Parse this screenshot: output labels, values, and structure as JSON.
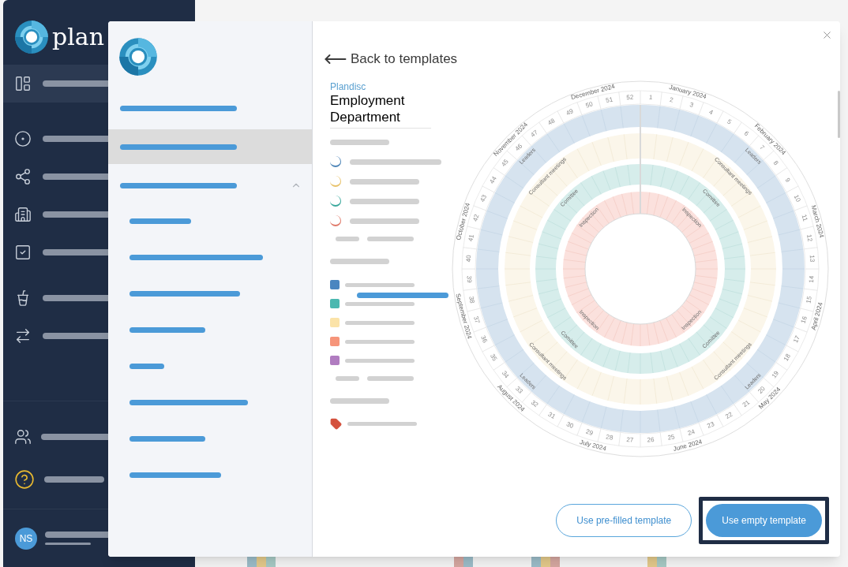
{
  "sidebar": {
    "logo_text": "plan",
    "items": [
      {
        "selected": true
      },
      {
        "selected": false
      },
      {
        "selected": false
      },
      {
        "selected": false
      },
      {
        "selected": false
      },
      {
        "selected": false
      },
      {
        "selected": false
      }
    ],
    "bottom_items": [
      {
        "selected": false
      },
      {
        "selected": false
      }
    ],
    "user": {
      "initials": "NS"
    }
  },
  "modal": {
    "nav": {
      "items": [
        {
          "selected": false
        },
        {
          "selected": true
        },
        {
          "selected": false,
          "expanded": true,
          "children": [
            {
              "selected": false
            },
            {
              "selected": false
            },
            {
              "selected": false
            },
            {
              "selected": false
            },
            {
              "selected": false
            },
            {
              "selected": false
            },
            {
              "selected": false
            },
            {
              "selected": false
            }
          ]
        }
      ]
    },
    "back_link": "Back to templates",
    "template": {
      "brand": "Plandisc",
      "title": "Employment Department",
      "ring_legend": [
        {
          "color": "#4f86b8"
        },
        {
          "color": "#e8c26a"
        },
        {
          "color": "#3aa89c"
        },
        {
          "color": "#e07a6a"
        }
      ],
      "category_legend": [
        {
          "color": "#4a86c0"
        },
        {
          "color": "#4ab8b0"
        },
        {
          "color": "#fbe3a8"
        },
        {
          "color": "#f6957a"
        },
        {
          "color": "#b07cc0"
        }
      ]
    },
    "wheel": {
      "months": [
        "January 2024",
        "February 2024",
        "March 2024",
        "April 2024",
        "May 2024",
        "June 2024",
        "July 2024",
        "August 2024",
        "September 2024",
        "October 2024",
        "November 2024",
        "December 2024"
      ],
      "weeks": [
        "1",
        "2",
        "3",
        "4",
        "5",
        "6",
        "7",
        "8",
        "9",
        "10",
        "11",
        "12",
        "13",
        "14",
        "15",
        "16",
        "17",
        "18",
        "19",
        "20",
        "21",
        "22",
        "23",
        "24",
        "25",
        "26",
        "27",
        "28",
        "29",
        "30",
        "31",
        "32",
        "33",
        "34",
        "35",
        "36",
        "37",
        "38",
        "39",
        "40",
        "41",
        "42",
        "43",
        "44",
        "45",
        "46",
        "47",
        "48",
        "49",
        "50",
        "51",
        "52"
      ],
      "rings": [
        {
          "color": "#d6e3ef",
          "labels": [
            "Leaders",
            "Leaders",
            "Leaders",
            "Leaders"
          ]
        },
        {
          "color": "#fbf6ea",
          "labels": [
            "Consultant meetings",
            "Consultant meetings",
            "Consultant meetings",
            "Consultant meetings"
          ]
        },
        {
          "color": "#d6edeb",
          "labels": [
            "Comittee",
            "Comittee",
            "Comittee",
            "Comittee"
          ]
        },
        {
          "color": "#fbe1dd",
          "labels": [
            "Inspection",
            "Inspection",
            "Inspection",
            "Inspection"
          ]
        }
      ]
    },
    "buttons": [
      {
        "label": "Use pre-filled template",
        "kind": "outline",
        "highlighted": false
      },
      {
        "label": "Use empty template",
        "kind": "primary",
        "highlighted": true
      }
    ]
  }
}
